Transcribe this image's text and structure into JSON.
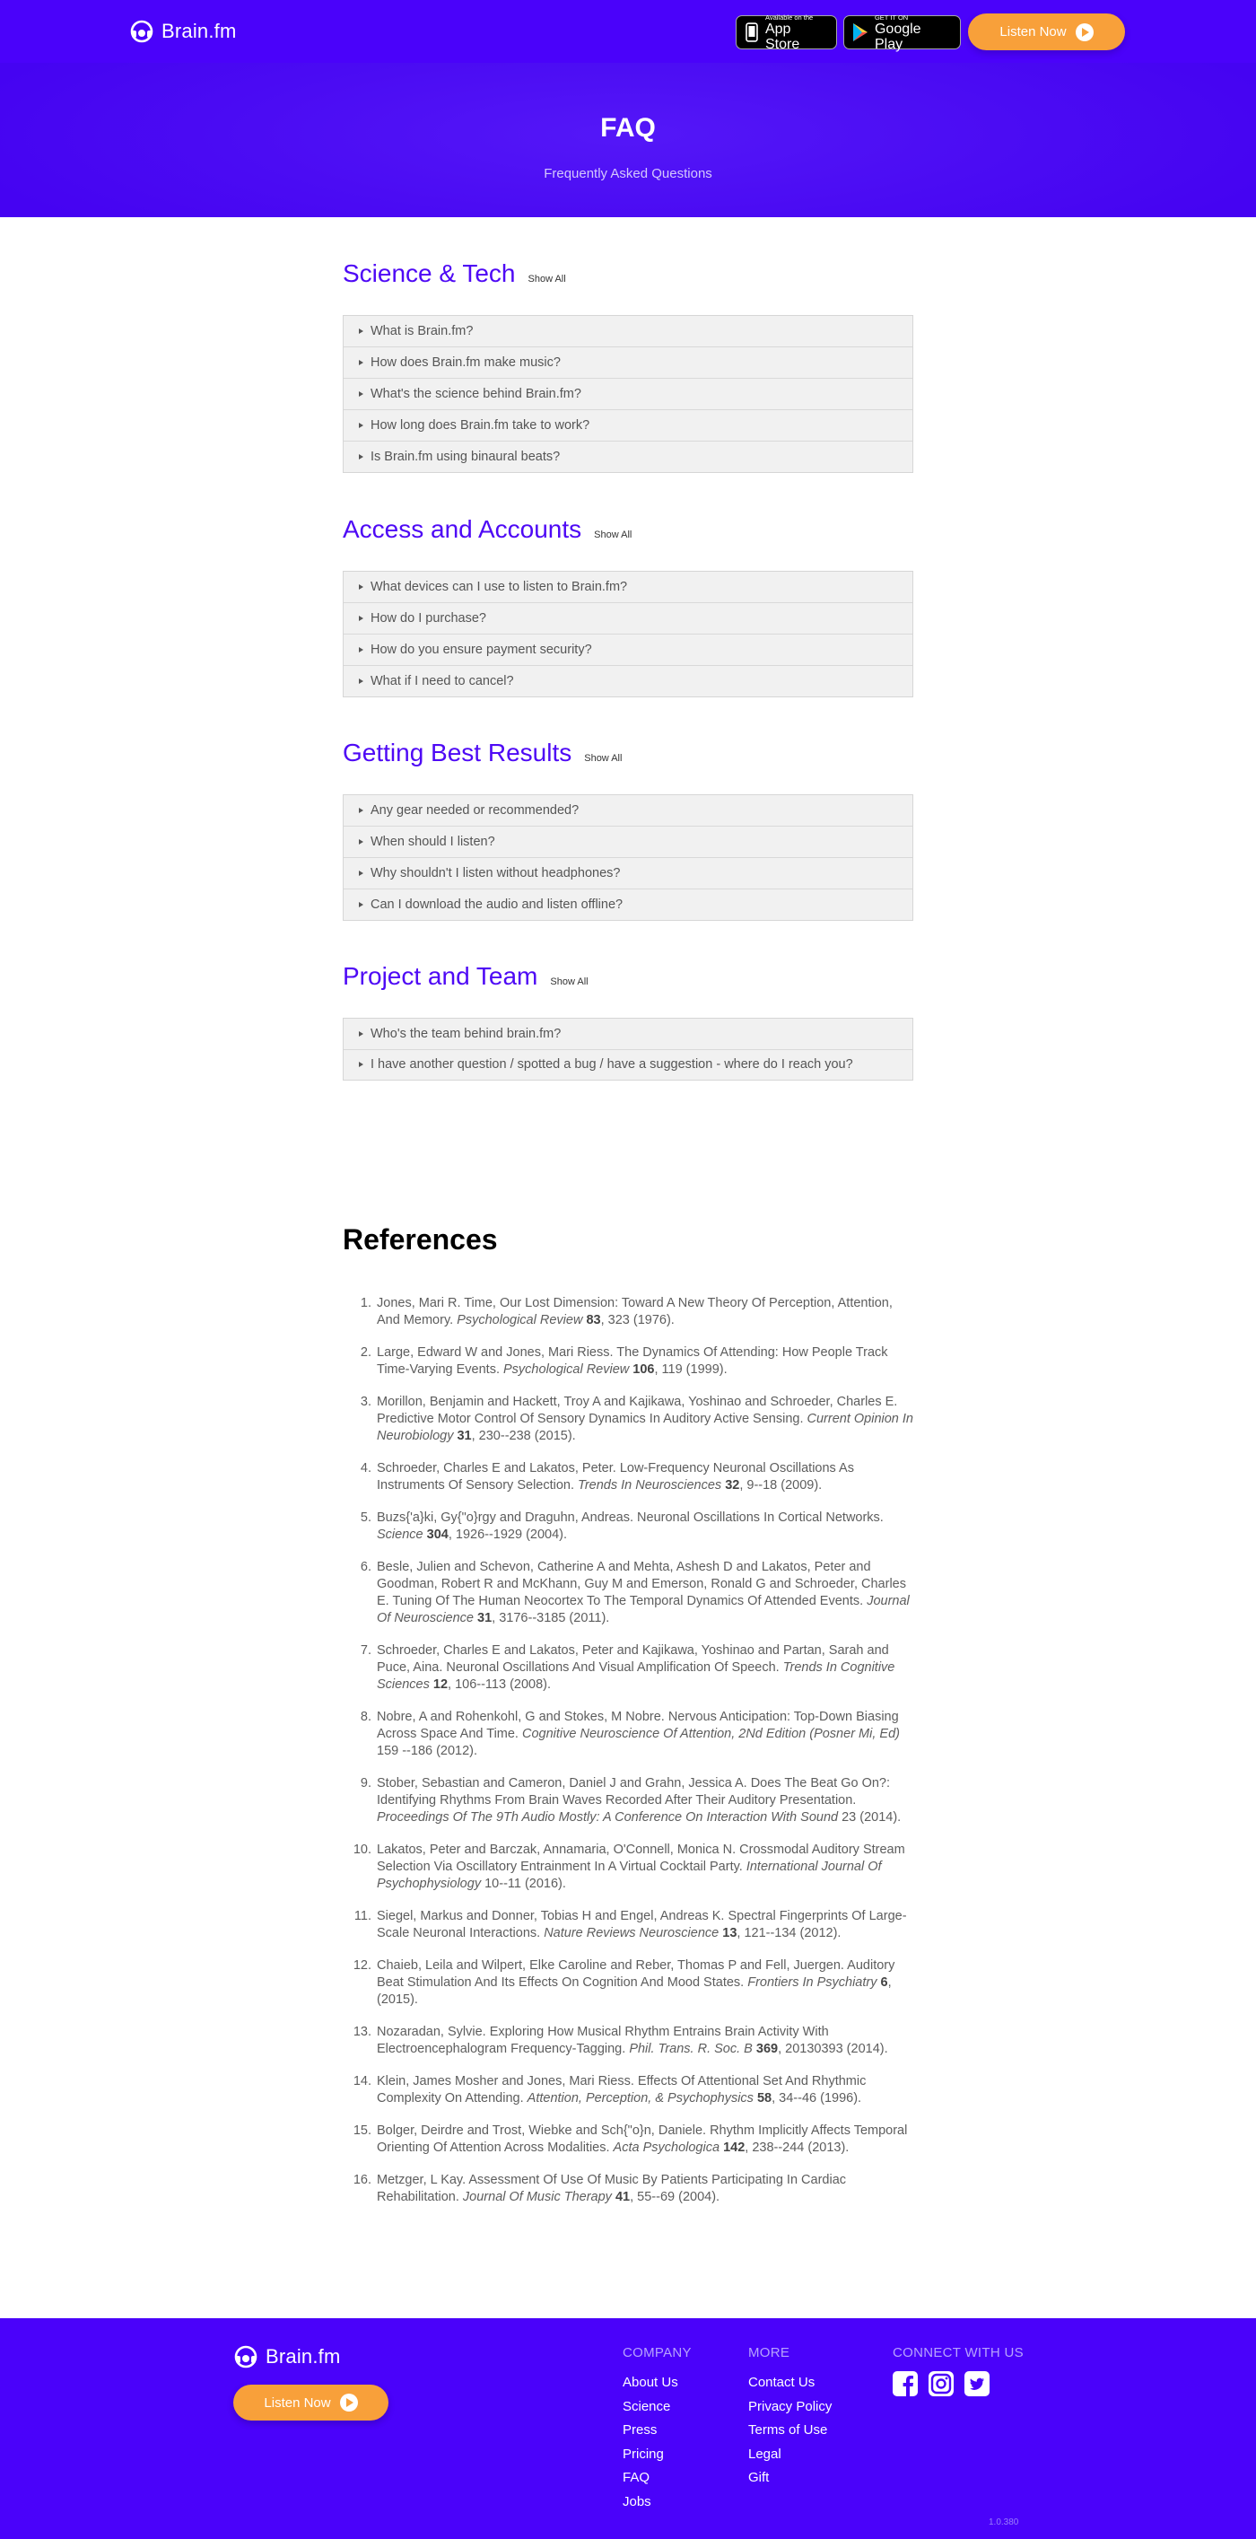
{
  "header": {
    "brand": "Brain.fm",
    "app_store": {
      "small": "Available on the",
      "big": "App Store"
    },
    "google_play": {
      "small": "GET IT ON",
      "big": "Google Play"
    },
    "listen_label": "Listen Now"
  },
  "hero": {
    "title": "FAQ",
    "subtitle": "Frequently Asked Questions"
  },
  "faq": {
    "show_all_label": "Show All",
    "sections": [
      {
        "title": "Science & Tech",
        "questions": [
          "What is Brain.fm?",
          "How does Brain.fm make music?",
          "What's the science behind Brain.fm?",
          "How long does Brain.fm take to work?",
          "Is Brain.fm using binaural beats?"
        ]
      },
      {
        "title": "Access and Accounts",
        "questions": [
          "What devices can I use to listen to Brain.fm?",
          "How do I purchase?",
          "How do you ensure payment security?",
          "What if I need to cancel?"
        ]
      },
      {
        "title": "Getting Best Results",
        "questions": [
          "Any gear needed or recommended?",
          "When should I listen?",
          "Why shouldn't I listen without headphones?",
          "Can I download the audio and listen offline?"
        ]
      },
      {
        "title": "Project and Team",
        "questions": [
          "Who's the team behind brain.fm?",
          "I have another question / spotted a bug / have a suggestion - where do I reach you?"
        ]
      }
    ]
  },
  "references": {
    "title": "References",
    "items": [
      {
        "num": "1.",
        "text": "Jones, Mari R. Time, Our Lost Dimension: Toward A New Theory Of Perception, Attention, And Memory. ",
        "journal": "Psychological Review",
        "vol": "83",
        "tail": ", 323 (1976)."
      },
      {
        "num": "2.",
        "text": "Large, Edward W and Jones, Mari Riess. The Dynamics Of Attending: How People Track Time-Varying Events. ",
        "journal": "Psychological Review",
        "vol": "106",
        "tail": ", 119 (1999)."
      },
      {
        "num": "3.",
        "text": "Morillon, Benjamin and Hackett, Troy A and Kajikawa, Yoshinao and Schroeder, Charles E. Predictive Motor Control Of Sensory Dynamics In Auditory Active Sensing. ",
        "journal": "Current Opinion In Neurobiology",
        "vol": "31",
        "tail": ", 230--238 (2015)."
      },
      {
        "num": "4.",
        "text": "Schroeder, Charles E and Lakatos, Peter. Low-Frequency Neuronal Oscillations As Instruments Of Sensory Selection. ",
        "journal": "Trends In Neurosciences",
        "vol": "32",
        "tail": ", 9--18 (2009)."
      },
      {
        "num": "5.",
        "text": "Buzs{'a}ki, Gy{\"o}rgy and Draguhn, Andreas. Neuronal Oscillations In Cortical Networks. ",
        "journal": "Science",
        "vol": "304",
        "tail": ", 1926--1929 (2004)."
      },
      {
        "num": "6.",
        "text": "Besle, Julien and Schevon, Catherine A and Mehta, Ashesh D and Lakatos, Peter and Goodman, Robert R and McKhann, Guy M and Emerson, Ronald G and Schroeder, Charles E. Tuning Of The Human Neocortex To The Temporal Dynamics Of Attended Events. ",
        "journal": "Journal Of Neuroscience",
        "vol": "31",
        "tail": ", 3176--3185 (2011)."
      },
      {
        "num": "7.",
        "text": "Schroeder, Charles E and Lakatos, Peter and Kajikawa, Yoshinao and Partan, Sarah and Puce, Aina. Neuronal Oscillations And Visual Amplification Of Speech. ",
        "journal": "Trends In Cognitive Sciences",
        "vol": "12",
        "tail": ", 106--113 (2008)."
      },
      {
        "num": "8.",
        "text": "Nobre, A and Rohenkohl, G and Stokes, M Nobre. Nervous Anticipation: Top-Down Biasing Across Space And Time. ",
        "journal": "Cognitive Neuroscience Of Attention, 2Nd Edition (Posner Mi, Ed)",
        "vol": "",
        "tail": " 159 --186 (2012)."
      },
      {
        "num": "9.",
        "text": "Stober, Sebastian and Cameron, Daniel J and Grahn, Jessica A. Does The Beat Go On?: Identifying Rhythms From Brain Waves Recorded After Their Auditory Presentation. ",
        "journal": "Proceedings Of The 9Th Audio Mostly: A Conference On Interaction With Sound",
        "vol": "",
        "tail": " 23 (2014)."
      },
      {
        "num": "10.",
        "text": "Lakatos, Peter and Barczak, Annamaria, O'Connell, Monica N. Crossmodal Auditory Stream Selection Via Oscillatory Entrainment In A Virtual Cocktail Party. ",
        "journal": "International Journal Of Psychophysiology",
        "vol": "",
        "tail": " 10--11 (2016)."
      },
      {
        "num": "11.",
        "text": "Siegel, Markus and Donner, Tobias H and Engel, Andreas K. Spectral Fingerprints Of Large-Scale Neuronal Interactions. ",
        "journal": "Nature Reviews Neuroscience",
        "vol": "13",
        "tail": ", 121--134 (2012)."
      },
      {
        "num": "12.",
        "text": "Chaieb, Leila and Wilpert, Elke Caroline and Reber, Thomas P and Fell, Juergen. Auditory Beat Stimulation And Its Effects On Cognition And Mood States. ",
        "journal": "Frontiers In Psychiatry",
        "vol": "6",
        "tail": ", (2015)."
      },
      {
        "num": "13.",
        "text": "Nozaradan, Sylvie. Exploring How Musical Rhythm Entrains Brain Activity With Electroencephalogram Frequency-Tagging. ",
        "journal": "Phil. Trans. R. Soc. B",
        "vol": "369",
        "tail": ", 20130393 (2014)."
      },
      {
        "num": "14.",
        "text": "Klein, James Mosher and Jones, Mari Riess. Effects Of Attentional Set And Rhythmic Complexity On Attending. ",
        "journal": "Attention, Perception, & Psychophysics",
        "vol": "58",
        "tail": ", 34--46 (1996)."
      },
      {
        "num": "15.",
        "text": "Bolger, Deirdre and Trost, Wiebke and Sch{\"o}n, Daniele. Rhythm Implicitly Affects Temporal Orienting Of Attention Across Modalities. ",
        "journal": "Acta Psychologica",
        "vol": "142",
        "tail": ", 238--244 (2013)."
      },
      {
        "num": "16.",
        "text": "Metzger, L Kay. Assessment Of Use Of Music By Patients Participating In Cardiac Rehabilitation. ",
        "journal": "Journal Of Music Therapy",
        "vol": "41",
        "tail": ", 55--69 (2004)."
      }
    ]
  },
  "footer": {
    "brand": "Brain.fm",
    "listen_label": "Listen Now",
    "company": {
      "heading": "COMPANY",
      "links": [
        "About Us",
        "Science",
        "Press",
        "Pricing",
        "FAQ",
        "Jobs"
      ]
    },
    "more": {
      "heading": "MORE",
      "links": [
        "Contact Us",
        "Privacy Policy",
        "Terms of Use",
        "Legal",
        "Gift"
      ]
    },
    "connect": {
      "heading": "CONNECT WITH US",
      "icons": [
        "facebook-icon",
        "instagram-icon",
        "twitter-icon"
      ]
    },
    "version": "1.0.380"
  },
  "colors": {
    "brand_purple": "#4a02fa",
    "accent_orange": "#f8a03a",
    "section_title": "#4e09f5"
  }
}
